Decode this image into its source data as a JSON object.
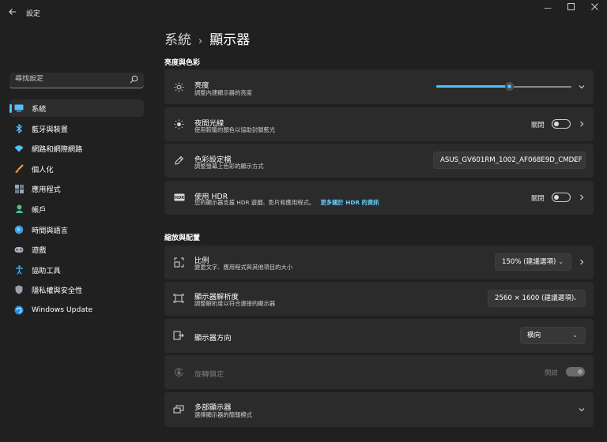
{
  "app": {
    "title": "設定"
  },
  "search": {
    "placeholder": "尋找設定"
  },
  "sidebar": {
    "items": [
      {
        "label": "系統",
        "icon": "system-icon",
        "active": true
      },
      {
        "label": "藍牙與裝置",
        "icon": "bluetooth-icon"
      },
      {
        "label": "網路和網際網路",
        "icon": "network-icon"
      },
      {
        "label": "個人化",
        "icon": "brush-icon"
      },
      {
        "label": "應用程式",
        "icon": "apps-icon"
      },
      {
        "label": "帳戶",
        "icon": "account-icon"
      },
      {
        "label": "時間與語言",
        "icon": "time-language-icon"
      },
      {
        "label": "遊戲",
        "icon": "gaming-icon"
      },
      {
        "label": "協助工具",
        "icon": "accessibility-icon"
      },
      {
        "label": "隱私權與安全性",
        "icon": "privacy-shield-icon"
      },
      {
        "label": "Windows Update",
        "icon": "windows-update-icon"
      }
    ]
  },
  "breadcrumb": {
    "parent": "系統",
    "separator": "›",
    "current": "顯示器"
  },
  "sections": {
    "brightness_color": "亮度與色彩",
    "scale_layout": "縮放與配置"
  },
  "settings": {
    "brightness": {
      "title": "亮度",
      "subtitle": "調整內建顯示器的亮度",
      "level": 0.54
    },
    "night_light": {
      "title": "夜間光線",
      "subtitle": "使用較暖的顏色以協助封鎖藍光",
      "toggle_label": "關閉",
      "on": false
    },
    "color_profile": {
      "title": "色彩設定檔",
      "subtitle": "調整螢幕上色彩的顯示方式",
      "value": "ASUS_GV601RM_1002_AF068E9D_CMDEF"
    },
    "hdr": {
      "title": "使用 HDR",
      "subtitle": "您的顯示器支援 HDR 遊戲、影片和應用程式。",
      "link": "更多關於 HDR 的資訊",
      "toggle_label": "關閉",
      "on": false,
      "badge": "HDR"
    },
    "scale": {
      "title": "比例",
      "subtitle": "變更文字、應用程式與其他項目的大小",
      "value": "150% (建議選項)"
    },
    "resolution": {
      "title": "顯示器解析度",
      "subtitle": "調整解析度以符合連接的顯示器",
      "value": "2560 × 1600 (建議選項)"
    },
    "orientation": {
      "title": "顯示器方向",
      "value": "橫向"
    },
    "rotation_lock": {
      "title": "旋轉鎖定",
      "toggle_label": "開啟",
      "on": true,
      "disabled": true
    },
    "multiple_displays": {
      "title": "多部顯示器",
      "subtitle": "選擇顯示器的簡報模式"
    }
  },
  "colors": {
    "accent": "#4cc2ff",
    "link": "#60cdff",
    "background": "#202020",
    "card": "#2b2b2b"
  }
}
